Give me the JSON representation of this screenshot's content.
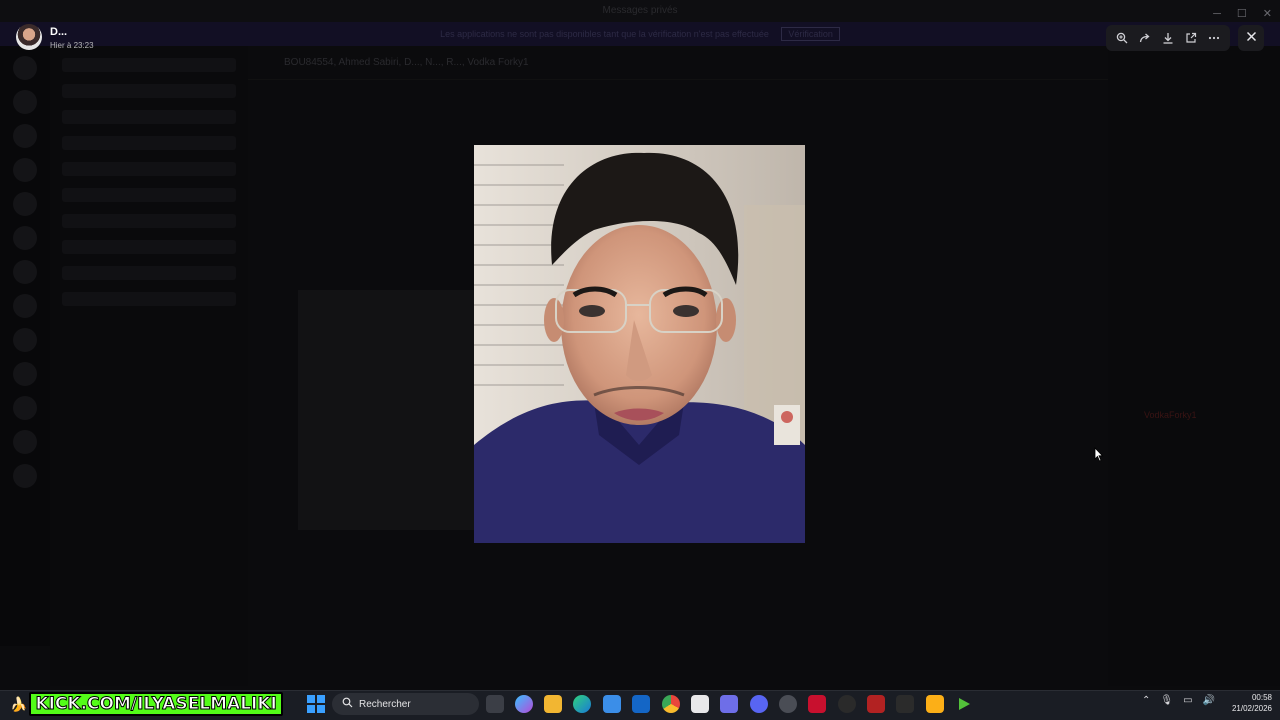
{
  "window": {
    "title": "Messages privés"
  },
  "banner": {
    "text": "Les applications ne sont pas disponibles tant que la vérification n'est pas effectuée",
    "button_label": "Vérification"
  },
  "chat": {
    "header_title": "BOU84554, Ahmed Sabiri, D..., N..., R..., Vodka Forky1"
  },
  "members": {
    "highlight_name": "VodkaForky1"
  },
  "viewer": {
    "author_name": "D...",
    "timestamp": "Hier à 23:23",
    "toolbar_icons": [
      "zoom-in-icon",
      "forward-icon",
      "download-icon",
      "open-external-icon",
      "more-icon"
    ],
    "close_icon": "close-icon"
  },
  "taskbar": {
    "kick_text": "KICK.COM/ILYASELMALIKI",
    "search_placeholder": "Rechercher",
    "apps": [
      "task-view",
      "copilot",
      "file-explorer",
      "edge",
      "store",
      "outlook",
      "chrome",
      "app-7",
      "game-app",
      "discord",
      "chromium",
      "app-11",
      "app-12",
      "wuthering",
      "epic-games",
      "rockstar",
      "app-17"
    ],
    "clock_time": "00:58",
    "clock_date": "21/02/2026"
  },
  "colors": {
    "accent": "#53fc18",
    "toolbar_bg": "#1b1b1f",
    "taskbar_bg": "#1a1d24"
  }
}
